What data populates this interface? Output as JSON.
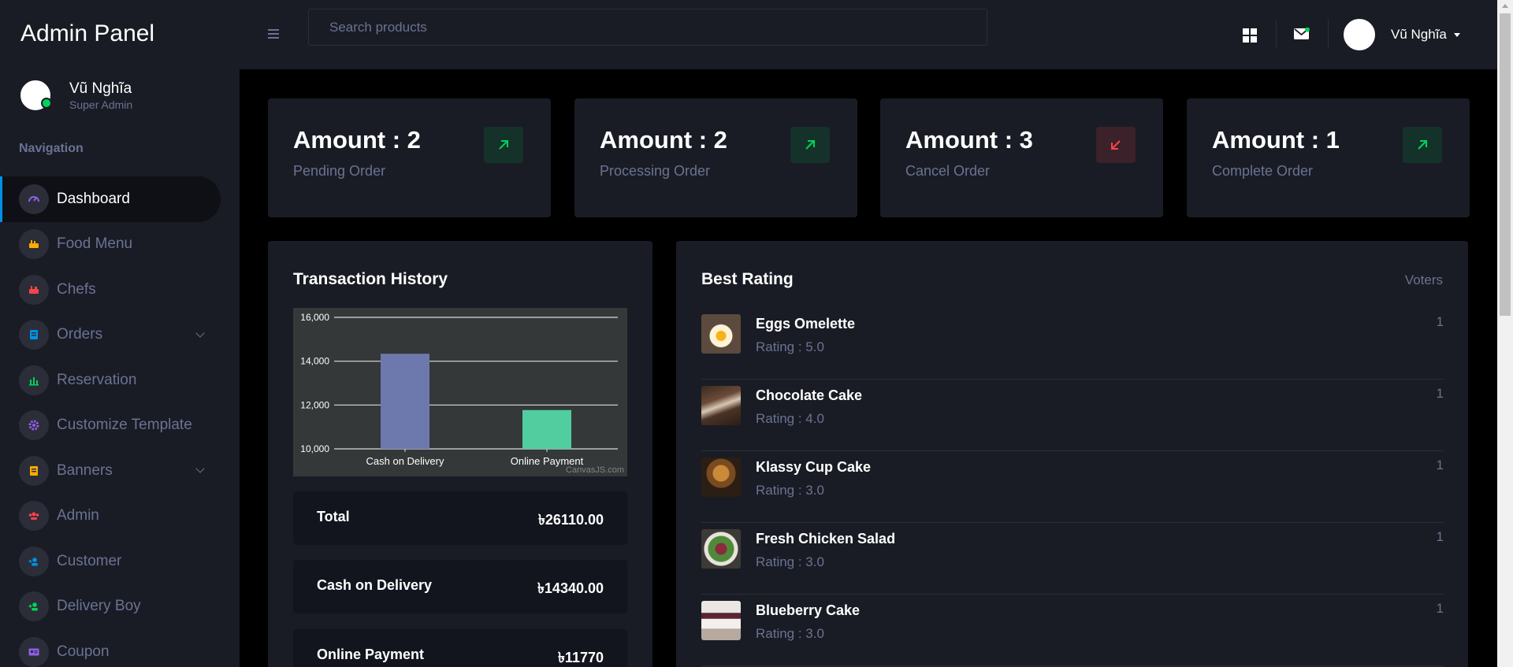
{
  "sidebar": {
    "brand": "Admin Panel",
    "profile": {
      "name": "Vũ Nghĩa",
      "role": "Super Admin"
    },
    "nav_caption": "Navigation",
    "items": [
      {
        "label": "Dashboard",
        "icon": "speedometer-icon",
        "color": "#8f5fe8",
        "active": true
      },
      {
        "label": "Food Menu",
        "icon": "food-icon",
        "color": "#ffab00"
      },
      {
        "label": "Chefs",
        "icon": "chef-icon",
        "color": "#fc424a"
      },
      {
        "label": "Orders",
        "icon": "orders-icon",
        "color": "#0090e7",
        "expandable": true
      },
      {
        "label": "Reservation",
        "icon": "chart-bar-icon",
        "color": "#00d25b"
      },
      {
        "label": "Customize Template",
        "icon": "gear-icon",
        "color": "#8f5fe8"
      },
      {
        "label": "Banners",
        "icon": "banner-icon",
        "color": "#ffab00",
        "expandable": true
      },
      {
        "label": "Admin",
        "icon": "admin-group-icon",
        "color": "#fc424a"
      },
      {
        "label": "Customer",
        "icon": "customer-icon",
        "color": "#0090e7"
      },
      {
        "label": "Delivery Boy",
        "icon": "delivery-icon",
        "color": "#00d25b"
      },
      {
        "label": "Coupon",
        "icon": "coupon-icon",
        "color": "#8f5fe8"
      }
    ]
  },
  "topbar": {
    "search_placeholder": "Search products",
    "user_name": "Vũ Nghĩa"
  },
  "stats": [
    {
      "amount": "Amount : 2",
      "label": "Pending Order",
      "trend": "up"
    },
    {
      "amount": "Amount : 2",
      "label": "Processing Order",
      "trend": "up"
    },
    {
      "amount": "Amount : 3",
      "label": "Cancel Order",
      "trend": "down"
    },
    {
      "amount": "Amount : 1",
      "label": "Complete Order",
      "trend": "up"
    }
  ],
  "transaction": {
    "title": "Transaction History",
    "rows": [
      {
        "label": "Total",
        "value": "৳26110.00"
      },
      {
        "label": "Cash on Delivery",
        "value": "৳14340.00"
      },
      {
        "label": "Online Payment",
        "value": "৳11770"
      }
    ]
  },
  "chart_data": {
    "type": "bar",
    "categories": [
      "Cash on Delivery",
      "Online Payment"
    ],
    "values": [
      14340,
      11770
    ],
    "colors": [
      "#6d78ad",
      "#51cda0"
    ],
    "ylim": [
      10000,
      16000
    ],
    "yticks": [
      "10,000",
      "12,000",
      "14,000",
      "16,000"
    ],
    "grid": true,
    "watermark": "CanvasJS.com"
  },
  "rating": {
    "title": "Best Rating",
    "voters_header": "Voters",
    "items": [
      {
        "name": "Eggs Omelette",
        "rating": "Rating : 5.0",
        "voters": "1"
      },
      {
        "name": "Chocolate Cake",
        "rating": "Rating : 4.0",
        "voters": "1"
      },
      {
        "name": "Klassy Cup Cake",
        "rating": "Rating : 3.0",
        "voters": "1"
      },
      {
        "name": "Fresh Chicken Salad",
        "rating": "Rating : 3.0",
        "voters": "1"
      },
      {
        "name": "Blueberry Cake",
        "rating": "Rating : 3.0",
        "voters": "1"
      }
    ]
  }
}
